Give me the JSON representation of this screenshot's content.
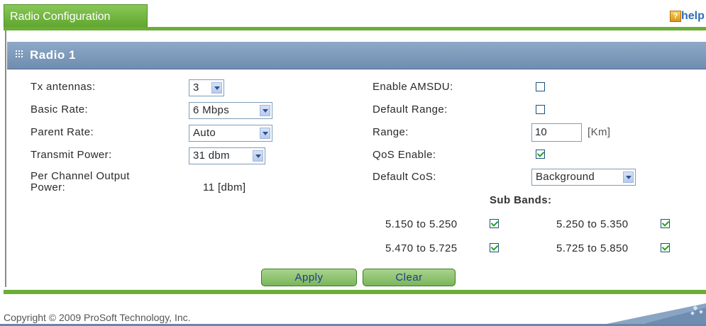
{
  "header": {
    "tab_title": "Radio Configuration",
    "help_icon_glyph": "?",
    "help_label": "help"
  },
  "panel": {
    "title": "Radio 1"
  },
  "left_fields": {
    "tx_antennas": {
      "label": "Tx antennas:",
      "value": "3"
    },
    "basic_rate": {
      "label": "Basic Rate:",
      "value": "6 Mbps"
    },
    "parent_rate": {
      "label": "Parent Rate:",
      "value": "Auto"
    },
    "transmit_power": {
      "label": "Transmit Power:",
      "value": "31 dbm"
    },
    "per_channel": {
      "label_line1": "Per Channel Output",
      "label_line2": "Power:",
      "value": "11 [dbm]"
    }
  },
  "right_fields": {
    "enable_amsdu": {
      "label": "Enable AMSDU:",
      "checked": false
    },
    "default_range": {
      "label": "Default Range:",
      "checked": false
    },
    "range": {
      "label": "Range:",
      "value": "10",
      "unit": "[Km]"
    },
    "qos_enable": {
      "label": "QoS Enable:",
      "checked": true
    },
    "default_cos": {
      "label": "Default CoS:",
      "value": "Background"
    }
  },
  "sub_bands": {
    "title": "Sub Bands:",
    "bands": [
      {
        "label": "5.150 to 5.250",
        "checked": true
      },
      {
        "label": "5.250 to 5.350",
        "checked": true
      },
      {
        "label": "5.470 to 5.725",
        "checked": true
      },
      {
        "label": "5.725 to 5.850",
        "checked": true
      }
    ]
  },
  "actions": {
    "apply_label": "Apply",
    "clear_label": "Clear"
  },
  "footer": {
    "copyright": "Copyright © 2009 ProSoft Technology, Inc."
  },
  "colors": {
    "accent_green": "#6aae38",
    "header_blue": "#7f9bbd",
    "check_green": "#22a322"
  }
}
